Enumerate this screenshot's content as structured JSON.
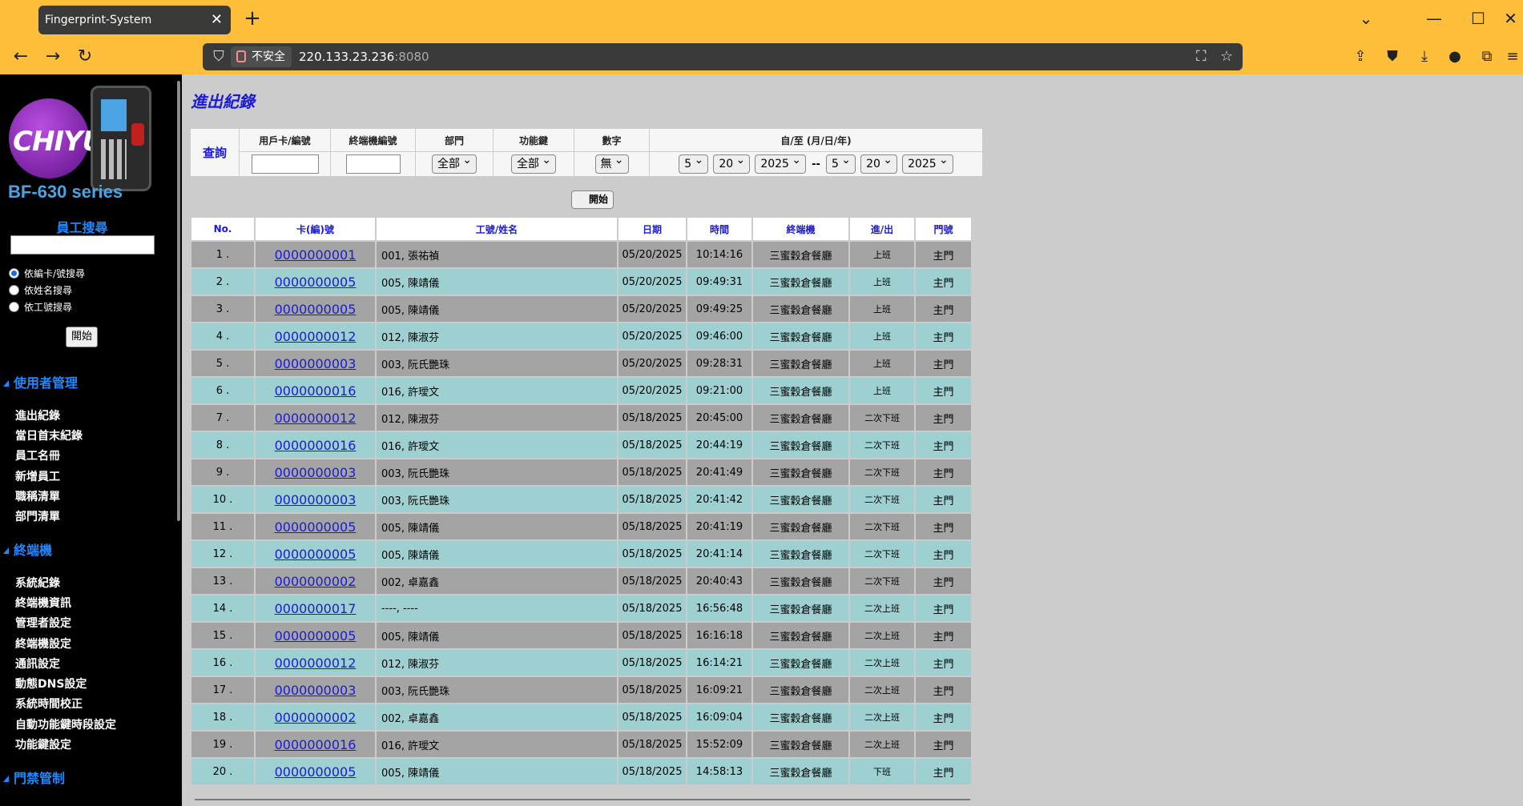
{
  "browser": {
    "tab_title": "Fingerprint-System",
    "insecure_label": "不安全",
    "url_host": "220.133.23.236",
    "url_port": ":8080"
  },
  "sidebar": {
    "logo_word": "CHIYU",
    "logo_series": "BF-630 series",
    "search_title": "員工搜尋",
    "radio_options": [
      {
        "label": "依編卡/號搜尋",
        "checked": true
      },
      {
        "label": "依姓名搜尋",
        "checked": false
      },
      {
        "label": "依工號搜尋",
        "checked": false
      }
    ],
    "search_button": "開始",
    "sections": [
      {
        "title": "使用者管理",
        "items": [
          "進出紀錄",
          "當日首末紀錄",
          "員工名冊",
          "新增員工",
          "職稱清單",
          "部門清單"
        ]
      },
      {
        "title": "終端機",
        "items": [
          "系統紀錄",
          "終端機資訊",
          "管理者設定",
          "終端機設定",
          "通訊設定",
          "動態DNS設定",
          "系統時間校正",
          "自動功能鍵時段設定",
          "功能鍵設定"
        ]
      },
      {
        "title": "門禁管制",
        "items": []
      }
    ]
  },
  "main": {
    "title": "進出紀錄",
    "query": {
      "label": "查詢",
      "headers": [
        "用戶卡/編號",
        "終端機編號",
        "部門",
        "功能鍵",
        "數字",
        "自/至 (月/日/年)"
      ],
      "dept_value": "全部",
      "func_value": "全部",
      "digit_value": "無",
      "from_month": "5",
      "from_day": "20",
      "from_year": "2025",
      "range_sep": "--",
      "to_month": "5",
      "to_day": "20",
      "to_year": "2025",
      "start_button": "開始"
    },
    "table": {
      "headers": [
        "No.",
        "卡(編)號",
        "工號/姓名",
        "日期",
        "時間",
        "終端機",
        "進/出",
        "門號"
      ],
      "rows": [
        [
          "1 .",
          "0000000001",
          "001, 張祐禎",
          "05/20/2025",
          "10:14:16",
          "三蜜穀倉餐廳",
          "上班",
          "主門"
        ],
        [
          "2 .",
          "0000000005",
          "005, 陳靖儀",
          "05/20/2025",
          "09:49:31",
          "三蜜穀倉餐廳",
          "上班",
          "主門"
        ],
        [
          "3 .",
          "0000000005",
          "005, 陳靖儀",
          "05/20/2025",
          "09:49:25",
          "三蜜穀倉餐廳",
          "上班",
          "主門"
        ],
        [
          "4 .",
          "0000000012",
          "012, 陳淑芬",
          "05/20/2025",
          "09:46:00",
          "三蜜穀倉餐廳",
          "上班",
          "主門"
        ],
        [
          "5 .",
          "0000000003",
          "003, 阮氏艷珠",
          "05/20/2025",
          "09:28:31",
          "三蜜穀倉餐廳",
          "上班",
          "主門"
        ],
        [
          "6 .",
          "0000000016",
          "016, 許璦文",
          "05/20/2025",
          "09:21:00",
          "三蜜穀倉餐廳",
          "上班",
          "主門"
        ],
        [
          "7 .",
          "0000000012",
          "012, 陳淑芬",
          "05/18/2025",
          "20:45:00",
          "三蜜穀倉餐廳",
          "二次下班",
          "主門"
        ],
        [
          "8 .",
          "0000000016",
          "016, 許璦文",
          "05/18/2025",
          "20:44:19",
          "三蜜穀倉餐廳",
          "二次下班",
          "主門"
        ],
        [
          "9 .",
          "0000000003",
          "003, 阮氏艷珠",
          "05/18/2025",
          "20:41:49",
          "三蜜穀倉餐廳",
          "二次下班",
          "主門"
        ],
        [
          "10 .",
          "0000000003",
          "003, 阮氏艷珠",
          "05/18/2025",
          "20:41:42",
          "三蜜穀倉餐廳",
          "二次下班",
          "主門"
        ],
        [
          "11 .",
          "0000000005",
          "005, 陳靖儀",
          "05/18/2025",
          "20:41:19",
          "三蜜穀倉餐廳",
          "二次下班",
          "主門"
        ],
        [
          "12 .",
          "0000000005",
          "005, 陳靖儀",
          "05/18/2025",
          "20:41:14",
          "三蜜穀倉餐廳",
          "二次下班",
          "主門"
        ],
        [
          "13 .",
          "0000000002",
          "002, 卓嘉鑫",
          "05/18/2025",
          "20:40:43",
          "三蜜穀倉餐廳",
          "二次下班",
          "主門"
        ],
        [
          "14 .",
          "0000000017",
          "----, ----",
          "05/18/2025",
          "16:56:48",
          "三蜜穀倉餐廳",
          "二次上班",
          "主門"
        ],
        [
          "15 .",
          "0000000005",
          "005, 陳靖儀",
          "05/18/2025",
          "16:16:18",
          "三蜜穀倉餐廳",
          "二次上班",
          "主門"
        ],
        [
          "16 .",
          "0000000012",
          "012, 陳淑芬",
          "05/18/2025",
          "16:14:21",
          "三蜜穀倉餐廳",
          "二次上班",
          "主門"
        ],
        [
          "17 .",
          "0000000003",
          "003, 阮氏艷珠",
          "05/18/2025",
          "16:09:21",
          "三蜜穀倉餐廳",
          "二次上班",
          "主門"
        ],
        [
          "18 .",
          "0000000002",
          "002, 卓嘉鑫",
          "05/18/2025",
          "16:09:04",
          "三蜜穀倉餐廳",
          "二次上班",
          "主門"
        ],
        [
          "19 .",
          "0000000016",
          "016, 許璦文",
          "05/18/2025",
          "15:52:09",
          "三蜜穀倉餐廳",
          "二次上班",
          "主門"
        ],
        [
          "20 .",
          "0000000005",
          "005, 陳靖儀",
          "05/18/2025",
          "14:58:13",
          "三蜜穀倉餐廳",
          "下班",
          "主門"
        ]
      ]
    }
  }
}
